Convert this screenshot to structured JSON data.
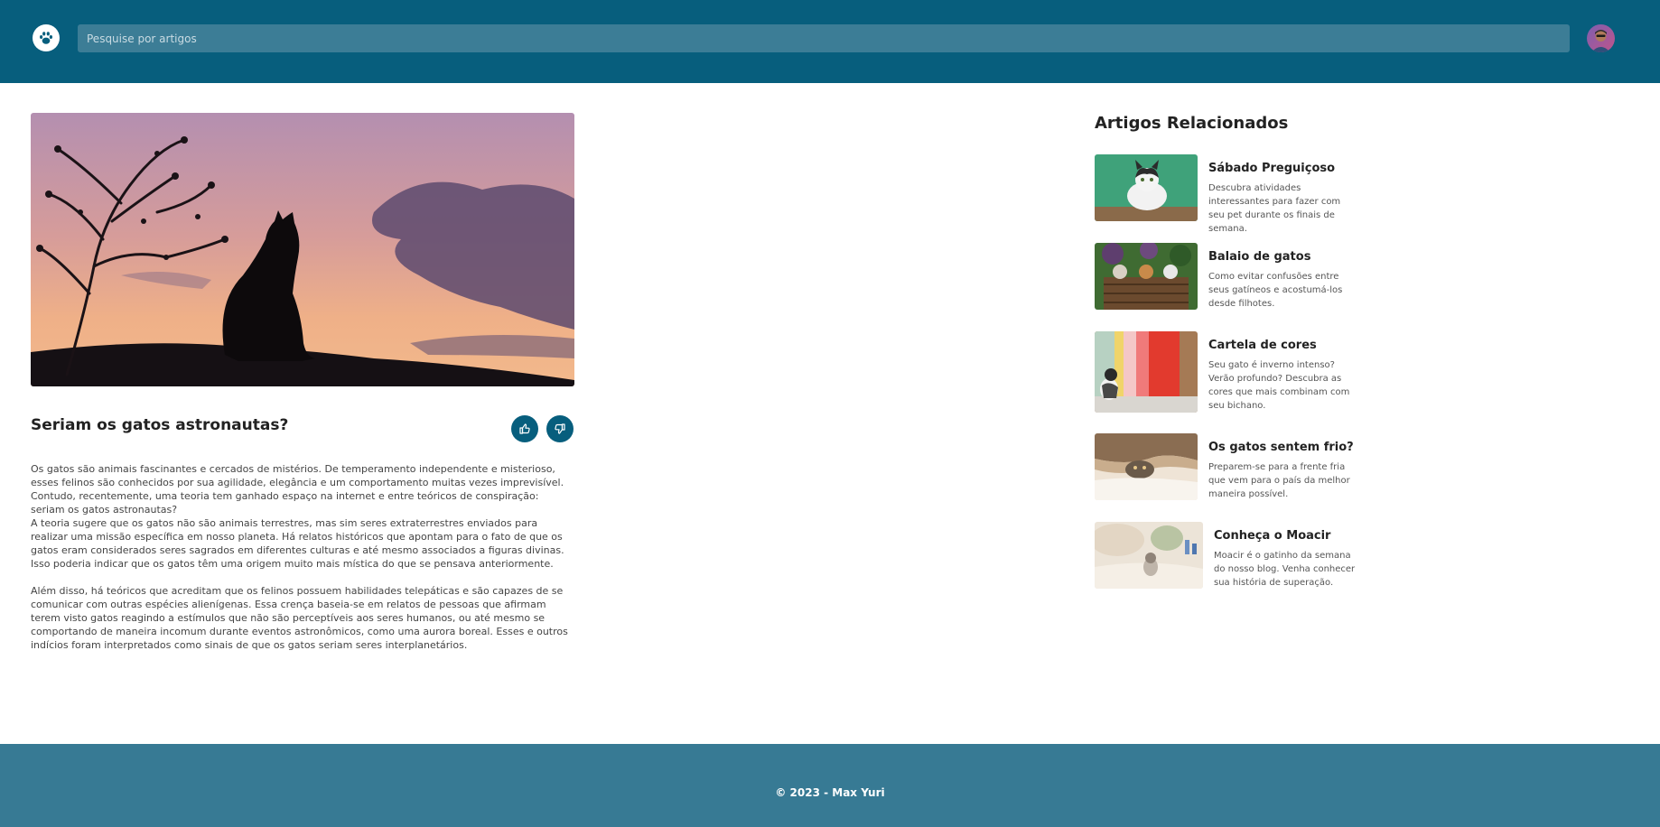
{
  "header": {
    "search_placeholder": "Pesquise por artigos",
    "logo_icon": "paw-icon",
    "brand_color": "#075e7d"
  },
  "article": {
    "title": "Seriam os gatos astronautas?",
    "like_icon": "thumbs-up-icon",
    "dislike_icon": "thumbs-down-icon",
    "paragraphs": [
      "Os gatos são animais fascinantes e cercados de mistérios. De temperamento independente e misterioso, esses felinos são conhecidos por sua agilidade, elegância e um comportamento muitas vezes imprevisível. Contudo, recentemente, uma teoria tem ganhado espaço na internet e entre teóricos de conspiração: seriam os gatos astronautas?",
      "A teoria sugere que os gatos não são animais terrestres, mas sim seres extraterrestres enviados para realizar uma missão específica em nosso planeta. Há relatos históricos que apontam para o fato de que os gatos eram considerados seres sagrados em diferentes culturas e até mesmo associados a figuras divinas. Isso poderia indicar que os gatos têm uma origem muito mais mística do que se pensava anteriormente.",
      "Além disso, há teóricos que acreditam que os felinos possuem habilidades telepáticas e são capazes de se comunicar com outras espécies alienígenas. Essa crença baseia-se em relatos de pessoas que afirmam terem visto gatos reagindo a estímulos que não são perceptíveis aos seres humanos, ou até mesmo se comportando de maneira incomum durante eventos astronômicos, como uma aurora boreal. Esses e outros indícios foram interpretados como sinais de que os gatos seriam seres interplanetários."
    ]
  },
  "related": {
    "title": "Artigos Relacionados",
    "items": [
      {
        "title": "Sábado Preguiçoso",
        "description": "Descubra atividades interessantes para fazer com seu pet durante os finais de semana."
      },
      {
        "title": "Balaio de gatos",
        "description": "Como evitar confusões entre seus gatíneos e acostumá-los desde filhotes."
      },
      {
        "title": "Cartela de cores",
        "description": "Seu gato é inverno intenso? Verão profundo? Descubra as cores que mais combinam com seu bichano."
      },
      {
        "title": "Os gatos sentem frio?",
        "description": "Preparem-se para a frente fria que vem para o país da melhor maneira possível."
      },
      {
        "title": "Conheça o Moacir",
        "description": "Moacir é o gatinho da semana do nosso blog. Venha conhecer sua história de superação."
      }
    ]
  },
  "footer": {
    "copyright": "© 2023 - Max Yuri",
    "color": "#377a94"
  }
}
